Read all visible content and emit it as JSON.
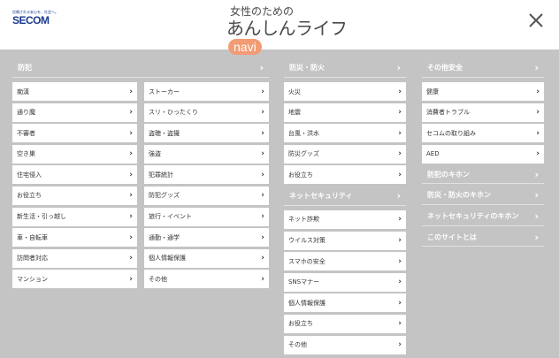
{
  "header": {
    "brand_tagline": "信頼される安心を、社会へ。",
    "brand_name": "SECOM",
    "logo_top": "女性のための",
    "logo_main": "あんしんライフ",
    "logo_badge": "navi"
  },
  "sections": {
    "crime": {
      "title": "防犯",
      "left": [
        "痴漢",
        "通り魔",
        "不審者",
        "空き巣",
        "住宅侵入",
        "お役立ち",
        "新生活・引っ越し",
        "車・自転車",
        "訪問者対応",
        "マンション"
      ],
      "right": [
        "ストーカー",
        "スリ・ひったくり",
        "盗聴・盗撮",
        "強盗",
        "犯罪統計",
        "防犯グッズ",
        "旅行・イベント",
        "通勤・通学",
        "個人情報保護",
        "その他"
      ]
    },
    "disaster": {
      "title": "防災・防火",
      "items": [
        "火災",
        "地震",
        "台風・洪水",
        "防災グッズ",
        "お役立ち"
      ]
    },
    "netsec": {
      "title": "ネットセキュリティ",
      "items": [
        "ネット詐欺",
        "ウイルス対策",
        "スマホの安全",
        "SNSマナー",
        "個人情報保護",
        "お役立ち",
        "その他"
      ]
    },
    "other": {
      "title": "その他安全",
      "items": [
        "健康",
        "消費者トラブル",
        "セコムの取り組み",
        "AED"
      ],
      "extra": [
        "防犯のキホン",
        "防災・防火のキホン",
        "ネットセキュリティのキホン",
        "このサイトとは"
      ]
    }
  },
  "colors": {
    "overlay": "#c4c4c4",
    "brand": "#1a3a8c",
    "badge": "#f29b74"
  }
}
